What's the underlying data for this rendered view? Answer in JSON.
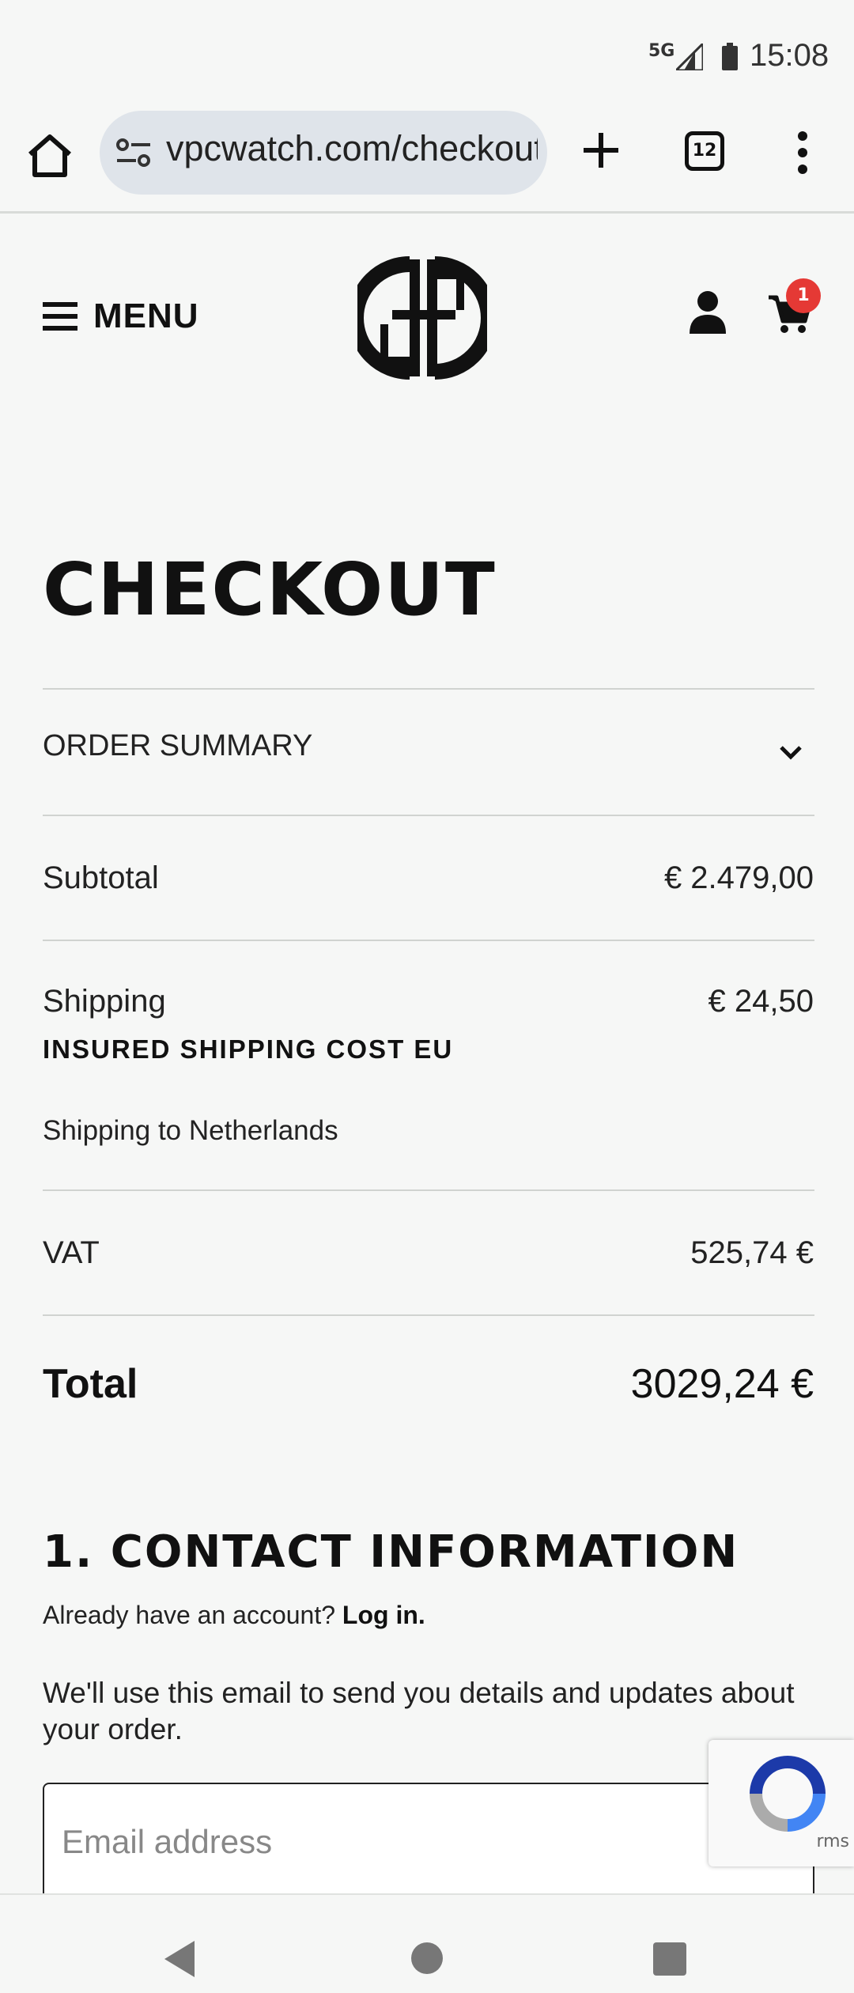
{
  "status_bar": {
    "network": "5G",
    "time": "15:08"
  },
  "browser": {
    "url": "vpcwatch.com/checkout",
    "tab_count": "12"
  },
  "header": {
    "menu_label": "MENU",
    "cart_count": "1"
  },
  "checkout": {
    "title": "CHECKOUT",
    "order_summary_label": "ORDER SUMMARY",
    "subtotal_label": "Subtotal",
    "subtotal_value": "€ 2.479,00",
    "shipping_label": "Shipping",
    "shipping_value": "€ 24,50",
    "shipping_method": "INSURED SHIPPING COST EU",
    "shipping_destination": "Shipping to Netherlands",
    "vat_label": "VAT",
    "vat_value": "525,74 €",
    "total_label": "Total",
    "total_value": "3029,24 €"
  },
  "contact": {
    "heading": "1. CONTACT INFORMATION",
    "account_prompt": "Already have an account?",
    "login_link": "Log in.",
    "email_note": "We'll use this email to send you details and updates about your order.",
    "email_placeholder": "Email address",
    "recaptcha_terms": "rms"
  },
  "colors": {
    "badge": "#e53935",
    "url_pill": "#dfe4ea",
    "background": "#f6f7f6"
  }
}
